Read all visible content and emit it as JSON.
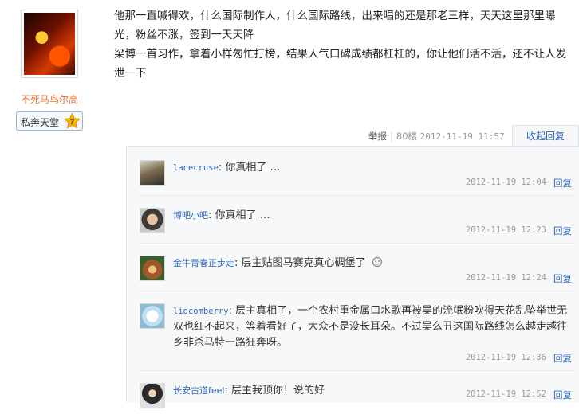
{
  "author": {
    "username": "不死马鸟尔高",
    "badge_text": "私奔天堂",
    "badge_level": "7"
  },
  "post": {
    "lines": [
      "他那一直喊得欢，什么国际制作人，什么国际路线，出来唱的还是那老三样，天天这里那里曝光，粉丝不涨，签到一天天降",
      "梁博一首习作，拿着小样匆忙打榜，结果人气口碑成绩都杠杠的，你让他们活不活，还不让人发泄一下"
    ]
  },
  "meta": {
    "report": "举报",
    "floor": "80楼",
    "timestamp": "2012-11-19 11:57",
    "collapse_reply": "收起回复"
  },
  "comments": [
    {
      "user": "lanecruse",
      "text": "你真相了 …",
      "time": "2012-11-19 12:04",
      "reply": "回复"
    },
    {
      "user": "博吧小吧",
      "text": "你真相了 …",
      "time": "2012-11-19 12:23",
      "reply": "回复"
    },
    {
      "user": "金牛青春正步走",
      "text": "层主贴图马赛克真心碉堡了",
      "time": "2012-11-19 12:24",
      "reply": "回复"
    },
    {
      "user": "lidcomberry",
      "text": "层主真相了，一个农村重金属口水歌再被吴的流氓粉吹得天花乱坠举世无双也红不起来，等着看好了，大众不是没长耳朵。不过吴么丑这国际路线怎么越走越往乡非杀马特一路狂奔呀。",
      "time": "2012-11-19 12:36",
      "reply": "回复"
    },
    {
      "user": "长安古道feel",
      "text": "层主我顶你！说的好",
      "time": "2012-11-19 12:52",
      "reply": "回复"
    }
  ],
  "colors": {
    "link": "#2d64b3",
    "username_orange": "#e0702a",
    "reply_bg": "#f7f8fa"
  }
}
